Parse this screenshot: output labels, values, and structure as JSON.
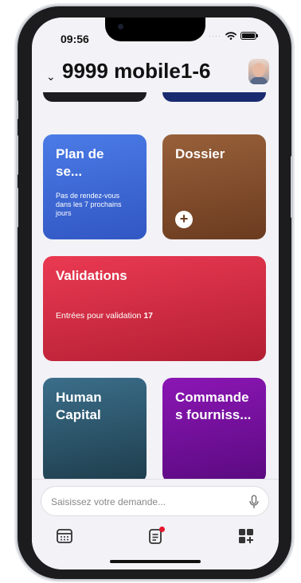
{
  "status_bar": {
    "time": "09:56"
  },
  "header": {
    "title": "9999 mobile1-6"
  },
  "tiles": {
    "plan": {
      "title": "Plan de se...",
      "subtitle": "Pas de rendez-vous dans les 7 prochains jours"
    },
    "dossier": {
      "title": "Dossier"
    },
    "validations": {
      "title": "Validations",
      "subtitle": "Entrées pour validation",
      "count": "17"
    },
    "human": {
      "title": "Human Capital"
    },
    "commande": {
      "title": "Commande s fourniss..."
    }
  },
  "search": {
    "placeholder": "Saisissez votre demande..."
  },
  "tabbar": {
    "items": [
      {
        "icon": "calendar-icon"
      },
      {
        "icon": "clipboard-icon",
        "badge": true
      },
      {
        "icon": "apps-add-icon"
      }
    ]
  },
  "colors": {
    "plan": "#3f69d6",
    "dossier": "#7f4b2a",
    "validations": "#d42a42",
    "human": "#2f5568",
    "commande": "#7410a0",
    "badge": "#e5162d"
  }
}
